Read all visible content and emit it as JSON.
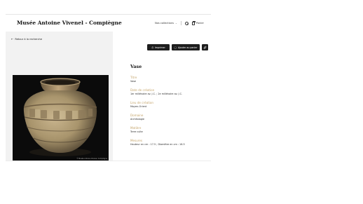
{
  "header": {
    "site_title": "Musée Antoine Vivenel - Compiègne",
    "collections_label": "Nos collections",
    "search_icon": "search-icon",
    "cart_label": "Panier",
    "cart_icon": "basket-icon"
  },
  "back_link": {
    "label": "Retour à la recherche",
    "icon": "arrow-left-icon"
  },
  "image": {
    "alt": "Vase",
    "credit": "© Musée Antoine Vivenel, Compiègne"
  },
  "actions": {
    "print_label": "Imprimer",
    "print_icon": "printer-icon",
    "cart_label": "Ajouter au panier",
    "cart_icon": "basket-icon",
    "link_icon": "link-icon"
  },
  "artwork": {
    "title": "Vase",
    "fields": [
      {
        "label": "Titre",
        "value": "Vase"
      },
      {
        "label": "Date de création",
        "value": "1er millénaire av. J.C. ; 2e millénaire av. J.C."
      },
      {
        "label": "Lieu de création",
        "value": "Moyen-Orient"
      },
      {
        "label": "Domaine",
        "value": "Archéologie"
      },
      {
        "label": "Matière",
        "value": "Terre cuite"
      },
      {
        "label": "Mesures",
        "value": "Hauteur en cm : 17.5 ; Diamètre en cm : 16.5"
      }
    ]
  },
  "colors": {
    "label_gold": "#c5a56b",
    "button_dark": "#1d1d1d",
    "panel_grey": "#f2f2f2"
  }
}
